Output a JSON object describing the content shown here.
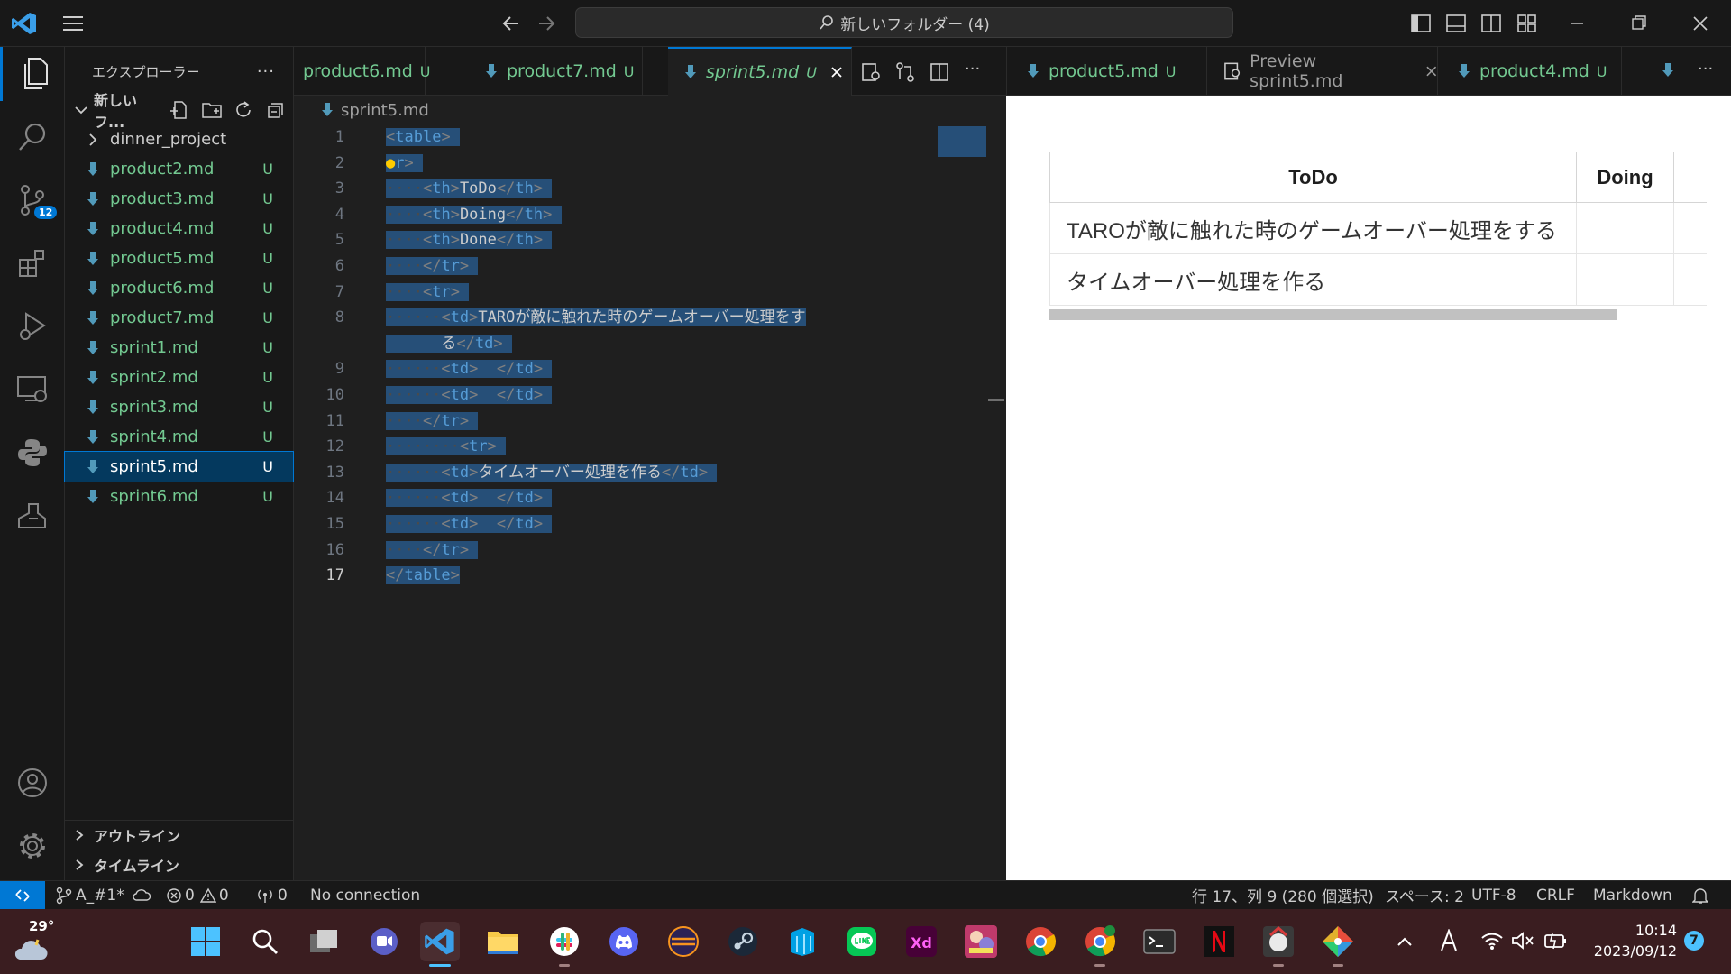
{
  "titlebar": {
    "search_text": "新しいフォルダー (4)"
  },
  "activity": {
    "scm_badge": "12"
  },
  "sidebar": {
    "title": "エクスプローラー",
    "folder_label": "新しいフ...",
    "items": [
      {
        "name": "dinner_project",
        "status": ""
      },
      {
        "name": "product2.md",
        "status": "U"
      },
      {
        "name": "product3.md",
        "status": "U"
      },
      {
        "name": "product4.md",
        "status": "U"
      },
      {
        "name": "product5.md",
        "status": "U"
      },
      {
        "name": "product6.md",
        "status": "U"
      },
      {
        "name": "product7.md",
        "status": "U"
      },
      {
        "name": "sprint1.md",
        "status": "U"
      },
      {
        "name": "sprint2.md",
        "status": "U"
      },
      {
        "name": "sprint3.md",
        "status": "U"
      },
      {
        "name": "sprint4.md",
        "status": "U"
      },
      {
        "name": "sprint5.md",
        "status": "U"
      },
      {
        "name": "sprint6.md",
        "status": "U"
      }
    ],
    "outline": "アウトライン",
    "timeline": "タイムライン"
  },
  "tabs_left": [
    {
      "label": "product6.md",
      "status": "U"
    },
    {
      "label": "product7.md",
      "status": "U"
    },
    {
      "label": "sprint5.md",
      "status": "U"
    }
  ],
  "tabs_right": [
    {
      "label": "product5.md",
      "status": "U"
    },
    {
      "label": "Preview sprint5.md"
    },
    {
      "label": "product4.md",
      "status": "U"
    }
  ],
  "editor": {
    "breadcrumb": "sprint5.md",
    "line_numbers": [
      "1",
      "2",
      "3",
      "4",
      "5",
      "6",
      "7",
      "8",
      "",
      "9",
      "10",
      "11",
      "12",
      "13",
      "14",
      "15",
      "16",
      "17"
    ],
    "cells": {
      "todo": "ToDo",
      "doing": "Doing",
      "done": "Done",
      "row1": "TAROが敵に触れた時のゲームオーバー処理をす",
      "row1_wrap": "る",
      "row2": "タイムオーバー処理を作る"
    }
  },
  "preview": {
    "headers": [
      "ToDo",
      "Doing"
    ],
    "rows": [
      "TAROが敵に触れた時のゲームオーバー処理をする",
      "タイムオーバー処理を作る"
    ]
  },
  "status": {
    "branch": "A_#1*",
    "errors": "0",
    "warnings": "0",
    "ports": "0",
    "connection": "No connection",
    "position": "行 17、列 9 (280 個選択)",
    "spaces": "スペース: 2",
    "encoding": "UTF-8",
    "eol": "CRLF",
    "language": "Markdown"
  },
  "taskbar": {
    "temperature": "29°",
    "time": "10:14",
    "date": "2023/09/12",
    "notif_count": "7"
  }
}
